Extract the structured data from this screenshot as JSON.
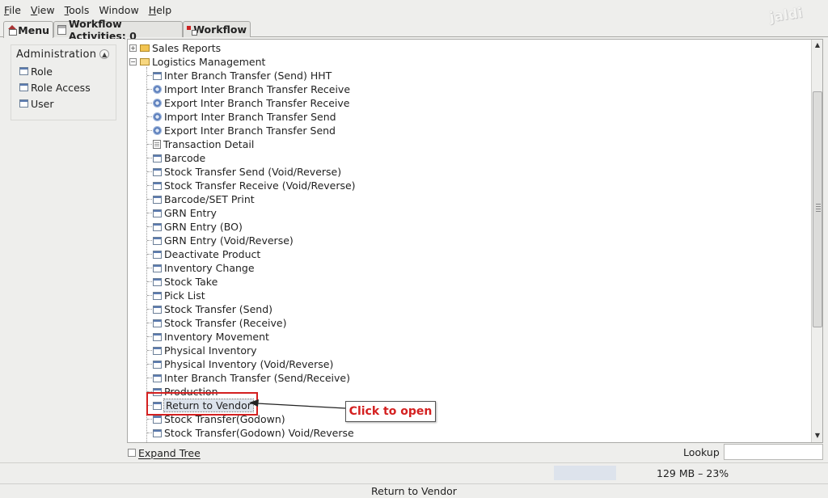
{
  "menubar": {
    "items": [
      {
        "label": "File",
        "mnemonic": "F",
        "rest": "ile"
      },
      {
        "label": "View",
        "mnemonic": "V",
        "rest": "iew"
      },
      {
        "label": "Tools",
        "mnemonic": "T",
        "rest": "ools"
      },
      {
        "label": "Window",
        "mnemonic": "",
        "rest": "Window"
      },
      {
        "label": "Help",
        "mnemonic": "H",
        "rest": "elp"
      }
    ],
    "brand": "jaldi"
  },
  "tabs": {
    "menu": "Menu",
    "workflow_activities": "Workflow Activities: 0",
    "workflow": "Workflow"
  },
  "sidebar": {
    "title": "Administration",
    "items": [
      "Role",
      "Role Access",
      "User"
    ]
  },
  "tree": {
    "folders": [
      "Sales Reports",
      "Logistics Management"
    ],
    "items": [
      {
        "label": "Inter Branch Transfer (Send) HHT",
        "icon": "window-icon"
      },
      {
        "label": "Import Inter Branch Transfer Receive",
        "icon": "gear-icon"
      },
      {
        "label": "Export Inter Branch Transfer Receive",
        "icon": "gear-icon"
      },
      {
        "label": "Import Inter Branch Transfer Send",
        "icon": "gear-icon"
      },
      {
        "label": "Export Inter Branch Transfer Send",
        "icon": "gear-icon"
      },
      {
        "label": "Transaction Detail",
        "icon": "document-icon"
      },
      {
        "label": "Barcode",
        "icon": "window-icon"
      },
      {
        "label": "Stock Transfer Send (Void/Reverse)",
        "icon": "window-icon"
      },
      {
        "label": "Stock Transfer Receive (Void/Reverse)",
        "icon": "window-icon"
      },
      {
        "label": "Barcode/SET Print",
        "icon": "window-icon"
      },
      {
        "label": "GRN Entry",
        "icon": "window-icon"
      },
      {
        "label": "GRN Entry (BO)",
        "icon": "window-icon"
      },
      {
        "label": "GRN Entry (Void/Reverse)",
        "icon": "window-icon"
      },
      {
        "label": "Deactivate Product",
        "icon": "window-icon"
      },
      {
        "label": "Inventory Change",
        "icon": "window-icon"
      },
      {
        "label": "Stock Take",
        "icon": "window-icon"
      },
      {
        "label": "Pick List",
        "icon": "window-icon"
      },
      {
        "label": "Stock Transfer (Send)",
        "icon": "window-icon"
      },
      {
        "label": "Stock Transfer (Receive)",
        "icon": "window-icon"
      },
      {
        "label": "Inventory Movement",
        "icon": "window-icon"
      },
      {
        "label": "Physical Inventory",
        "icon": "window-icon"
      },
      {
        "label": "Physical Inventory (Void/Reverse)",
        "icon": "window-icon"
      },
      {
        "label": "Inter Branch Transfer (Send/Receive)",
        "icon": "window-icon"
      },
      {
        "label": "Production",
        "icon": "window-icon"
      },
      {
        "label": "Return to Vendor",
        "icon": "window-icon",
        "selected": true
      },
      {
        "label": "Stock Transfer(Godown)",
        "icon": "window-icon"
      },
      {
        "label": "Stock Transfer(Godown) Void/Reverse",
        "icon": "window-icon"
      }
    ]
  },
  "annotation": {
    "callout": "Click to open"
  },
  "bottom": {
    "expand_tree": "Expand Tree",
    "lookup": "Lookup",
    "lookup_value": ""
  },
  "status": {
    "memory": "129 MB – 23%",
    "memory_percent": 23
  },
  "footer": {
    "text": "Return to Vendor"
  },
  "colors": {
    "accent": "#d42020",
    "selection": "#dce3ec"
  }
}
